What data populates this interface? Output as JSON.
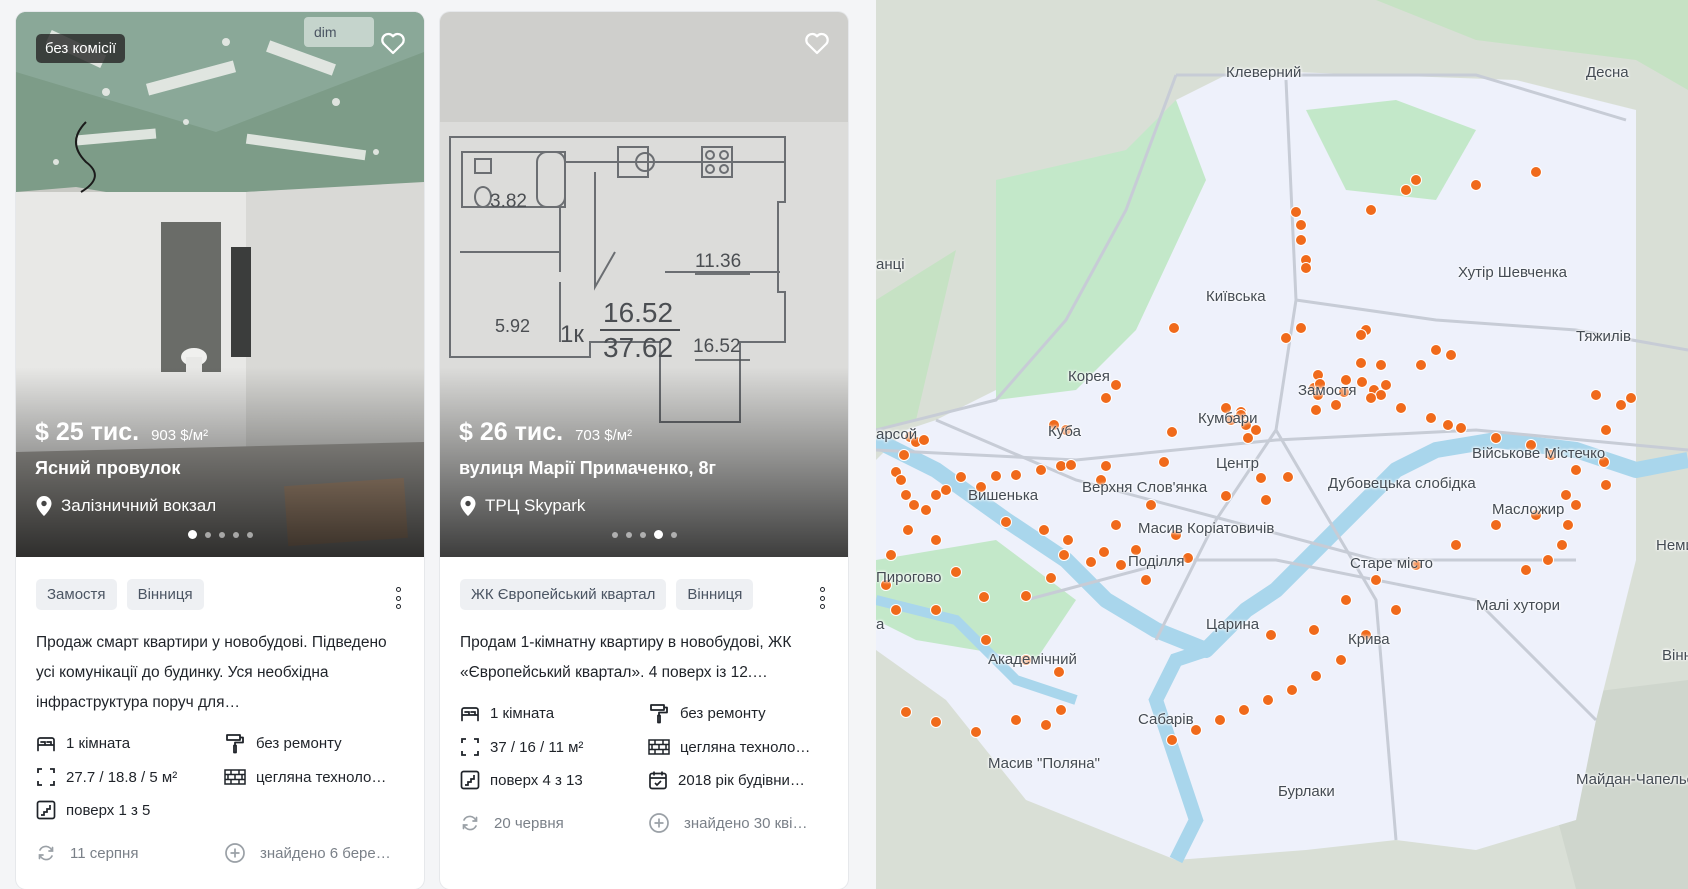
{
  "listings": [
    {
      "badge": "без комісії",
      "watermark": "dim",
      "price": "$ 25 тис.",
      "price_per_m2": "903 $/м²",
      "street": "Ясний провулок",
      "location": "Залізничний вокзал",
      "photo_index": 1,
      "photo_count": 5,
      "tags": [
        "Замостя",
        "Вінниця"
      ],
      "description": "Продаж смарт квартири у новобудові. Підведено усі комунікації до будинку. Уся необхідна інфраструктура поруч для…",
      "features": [
        "1 кімната",
        "без ремонту",
        "27.7 / 18.8 / 5 м²",
        "цегляна техноло…",
        "поверх 1 з 5"
      ],
      "date": "11 серпня",
      "found": "знайдено 6 бере…"
    },
    {
      "badge": "",
      "price": "$ 26 тис.",
      "price_per_m2": "703 $/м²",
      "street": "вулиця Марії Примаченко, 8г",
      "location": "ТРЦ Skypark",
      "photo_index": 4,
      "photo_count": 5,
      "tags": [
        "ЖК Європейський квартал",
        "Вінниця"
      ],
      "description": "Продам 1-кімнатну квартиру в новобудові, ЖК «Європейський квартал». 4 поверх із 12.…",
      "features": [
        "1 кімната",
        "без ремонту",
        "37 / 16 / 11 м²",
        "цегляна техноло…",
        "поверх 4 з 13",
        "2018 рік будівни…"
      ],
      "date": "20 червня",
      "found": "знайдено 30 кві…",
      "floorplan": {
        "kitchen": "11.36",
        "bath": "3.82",
        "hall": "5.92",
        "room": "16.52",
        "total": "37.62",
        "type": "1к",
        "room2": "16.52"
      }
    }
  ],
  "map": {
    "labels": [
      "Клеверний",
      "Десна",
      "Хутір Шевченка",
      "Київська",
      "Тяжилів",
      "Корея",
      "Замостя",
      "Кумбари",
      "Куба",
      "Вишенька",
      "Верхня Слов'янка",
      "Центр",
      "Дубовецька слобідка",
      "Військове Містечко",
      "Масив Коріатовичів",
      "Поділля",
      "Старе місто",
      "Масложир",
      "Пирогово",
      "Немирів",
      "Малі хутори",
      "Царина",
      "Крива",
      "Академічний",
      "Вінниця",
      "Сабарів",
      "Масив \"Поляна\"",
      "Бурлаки",
      "Майдан-Чапельськи",
      "анці",
      "арсой",
      "а"
    ],
    "marker_color": "#f06a1b",
    "area_color": "#eef1fb",
    "park_color": "#c3e8c9",
    "river_color": "#a9d6ec"
  },
  "icons": {
    "favorite": "heart-outline-icon",
    "location": "map-pin-icon",
    "rooms": "bed-icon",
    "repair": "paint-roller-icon",
    "area": "area-frame-icon",
    "material": "brick-icon",
    "floor": "stairs-icon",
    "year": "calendar-icon",
    "updated": "refresh-icon",
    "found": "plus-circle-icon"
  }
}
